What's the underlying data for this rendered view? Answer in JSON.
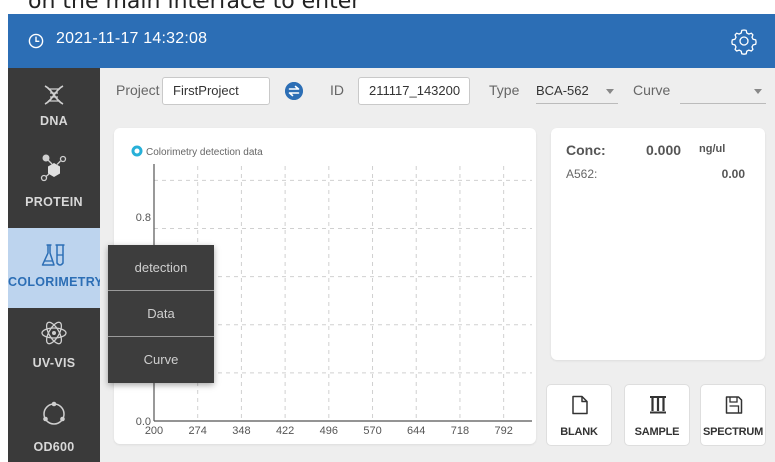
{
  "caption": {
    "text": "on the main interface to enter"
  },
  "header": {
    "datetime": "2021-11-17 14:32:08"
  },
  "sidebar": {
    "items": [
      {
        "label": "DNA",
        "icon": "dna-icon",
        "active": false
      },
      {
        "label": "PROTEIN",
        "icon": "protein-icon",
        "active": false
      },
      {
        "label": "COLORIMETRY",
        "icon": "flask-icon",
        "active": true
      },
      {
        "label": "UV-VIS",
        "icon": "atom-icon",
        "active": false
      },
      {
        "label": "OD600",
        "icon": "cell-icon",
        "active": false
      }
    ]
  },
  "form": {
    "project_label": "Project",
    "project_value": "FirstProject",
    "id_label": "ID",
    "id_value": "211117_143200",
    "type_label": "Type",
    "type_value": "BCA-562",
    "curve_label": "Curve",
    "curve_value": ""
  },
  "results": {
    "conc_label": "Conc:",
    "conc_value": "0.000",
    "conc_unit": "ng/ul",
    "a_label": "A562:",
    "a_value": "0.00"
  },
  "actions": {
    "blank": "BLANK",
    "sample": "SAMPLE",
    "spectrum": "SPECTRUM"
  },
  "popup_menu": {
    "items": [
      "detection",
      "Data",
      "Curve"
    ]
  },
  "chart_data": {
    "type": "line",
    "legend": "Colorimetry detection data",
    "x_ticks": [
      200,
      274,
      348,
      422,
      496,
      570,
      644,
      718,
      792
    ],
    "y_ticks": [
      0.0,
      0.8
    ],
    "y_tick_labels": [
      "0.0",
      "0.8"
    ],
    "xlim": [
      200,
      840
    ],
    "ylim": [
      0.0,
      1.0
    ],
    "grid": true,
    "series": [],
    "colors": {
      "legend_dot": "#27b0d8",
      "grid": "#d0d0d0",
      "axis": "#555555"
    }
  },
  "colors": {
    "primary": "#2c6eb5",
    "sidebar": "#3a3a3a",
    "active_nav": "#bdd4ee",
    "background": "#eeeeee"
  }
}
